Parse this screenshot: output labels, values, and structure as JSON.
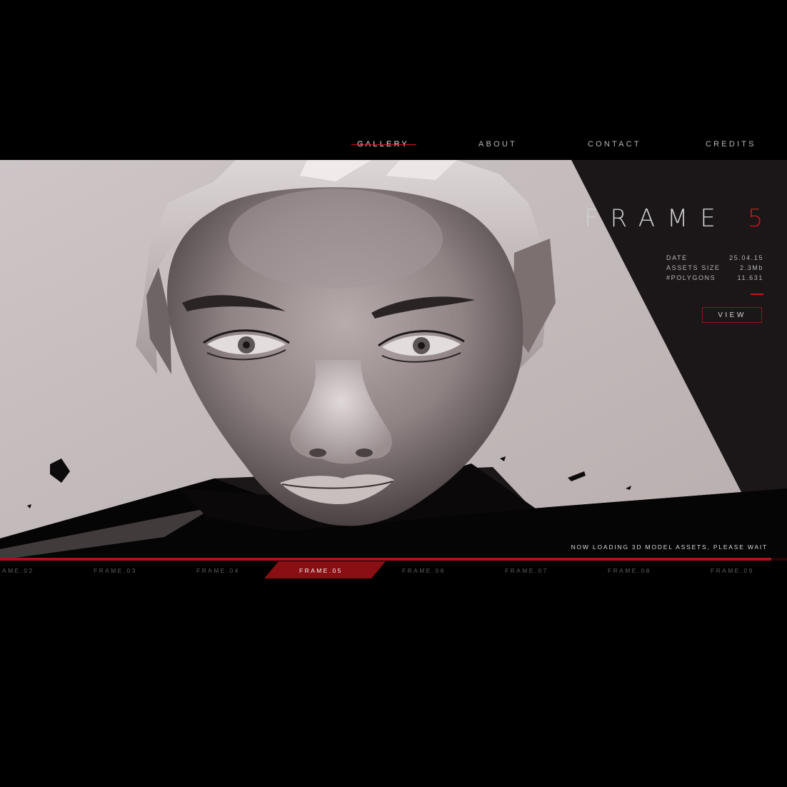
{
  "nav": {
    "items": [
      {
        "label": "GALLERY",
        "active": true
      },
      {
        "label": "ABOUT",
        "active": false
      },
      {
        "label": "CONTACT",
        "active": false
      },
      {
        "label": "CREDITS",
        "active": false
      }
    ]
  },
  "frame": {
    "title": "FRAME",
    "number": "5",
    "meta": {
      "date_label": "DATE",
      "date_value": "25.04.15",
      "size_label": "ASSETS SIZE",
      "size_value": "2.3Mb",
      "polygons_label": "#POLYGONS",
      "polygons_value": "11.631"
    },
    "view_label": "VIEW"
  },
  "loading": {
    "text": "NOW LOADING 3D MODEL ASSETS, PLEASE WAIT",
    "progress": 0.98
  },
  "frames": [
    {
      "label": "AME.02",
      "active": false
    },
    {
      "label": "FRAME.03",
      "active": false
    },
    {
      "label": "FRAME.04",
      "active": false
    },
    {
      "label": "FRAME.05",
      "active": true
    },
    {
      "label": "FRAME.06",
      "active": false
    },
    {
      "label": "FRAME.07",
      "active": false
    },
    {
      "label": "FRAME.08",
      "active": false
    },
    {
      "label": "FRAME.09",
      "active": false
    }
  ],
  "colors": {
    "accent": "#c8161d",
    "background": "#000000",
    "panel": "#1a1516",
    "render_light": "#ccc3c4"
  }
}
